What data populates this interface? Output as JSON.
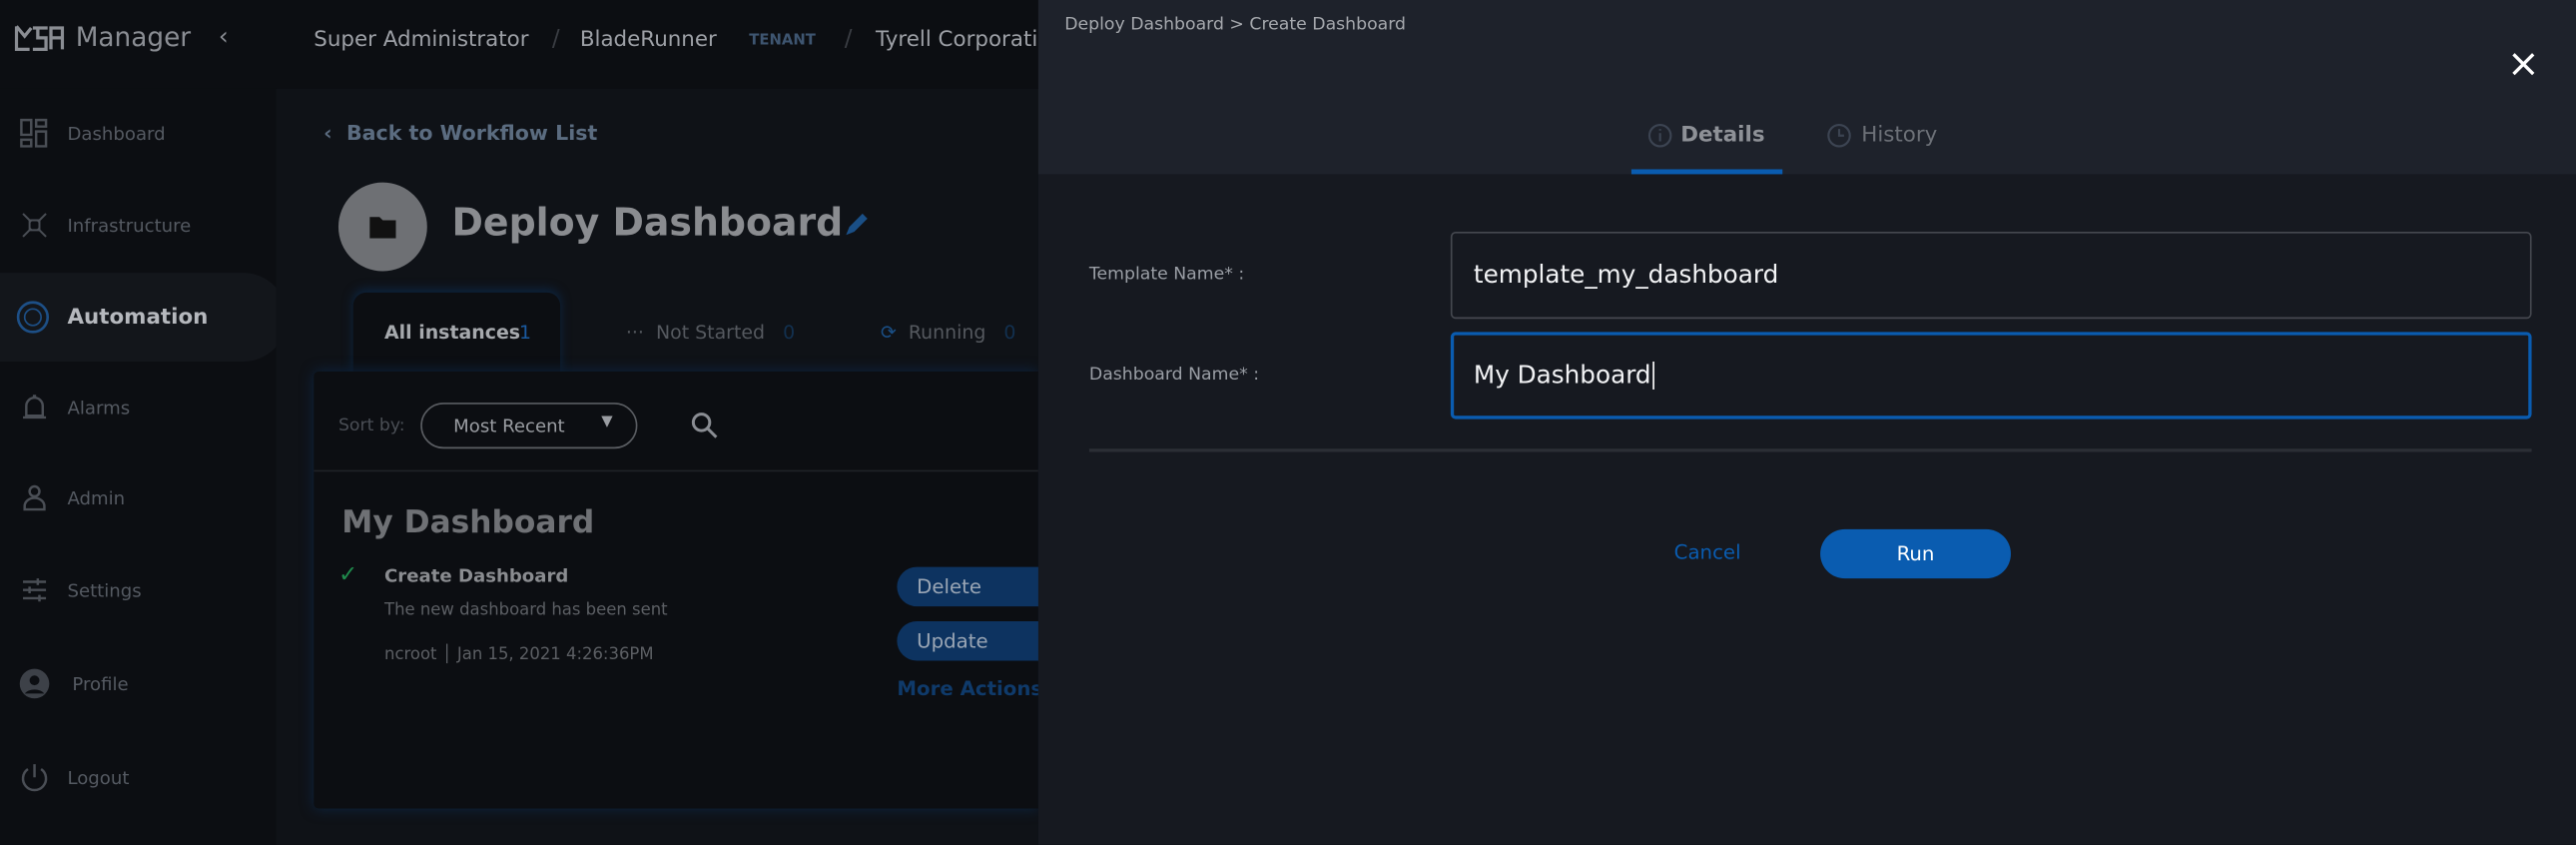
{
  "app": {
    "logo": "MSA",
    "title": "Manager"
  },
  "topbar": {
    "crumbs": [
      "Super Administrator",
      "BladeRunner",
      "Tyrell Corporati"
    ],
    "tenant_badge": "TENANT"
  },
  "sidebar": {
    "items": [
      {
        "label": "Dashboard",
        "icon": "dashboard-icon"
      },
      {
        "label": "Infrastructure",
        "icon": "infrastructure-icon"
      },
      {
        "label": "Automation",
        "icon": "automation-icon",
        "active": true
      },
      {
        "label": "Alarms",
        "icon": "bell-icon"
      },
      {
        "label": "Admin",
        "icon": "admin-icon"
      },
      {
        "label": "Settings",
        "icon": "sliders-icon"
      },
      {
        "label": "Profile",
        "icon": "profile-icon"
      },
      {
        "label": "Logout",
        "icon": "power-icon"
      }
    ]
  },
  "main": {
    "back_link": "Back to Workflow List",
    "title": "Deploy Dashboard",
    "tabs": [
      {
        "label": "All instances",
        "count": "1"
      },
      {
        "label": "Not Started",
        "count": "0"
      },
      {
        "label": "Running",
        "count": "0"
      }
    ],
    "sort_label": "Sort by:",
    "sort_value": "Most Recent",
    "instance": {
      "name": "My Dashboard",
      "step": "Create Dashboard",
      "message": "The new dashboard has been sent",
      "user": "ncroot",
      "timestamp": "Jan 15, 2021 4:26:36PM",
      "actions": [
        "Delete Dashboard",
        "Update Dashboard"
      ],
      "more_actions": "More Actions"
    }
  },
  "panel": {
    "breadcrumb": "Deploy Dashboard > Create Dashboard",
    "tabs": [
      {
        "label": "Details",
        "active": true
      },
      {
        "label": "History"
      }
    ],
    "fields": [
      {
        "label": "Template Name* :",
        "value": "template_my_dashboard"
      },
      {
        "label": "Dashboard Name* :",
        "value": "My Dashboard"
      }
    ],
    "cancel": "Cancel",
    "run": "Run"
  },
  "colors": {
    "accent": "#0a5cb0",
    "success": "#1f8a4c"
  }
}
